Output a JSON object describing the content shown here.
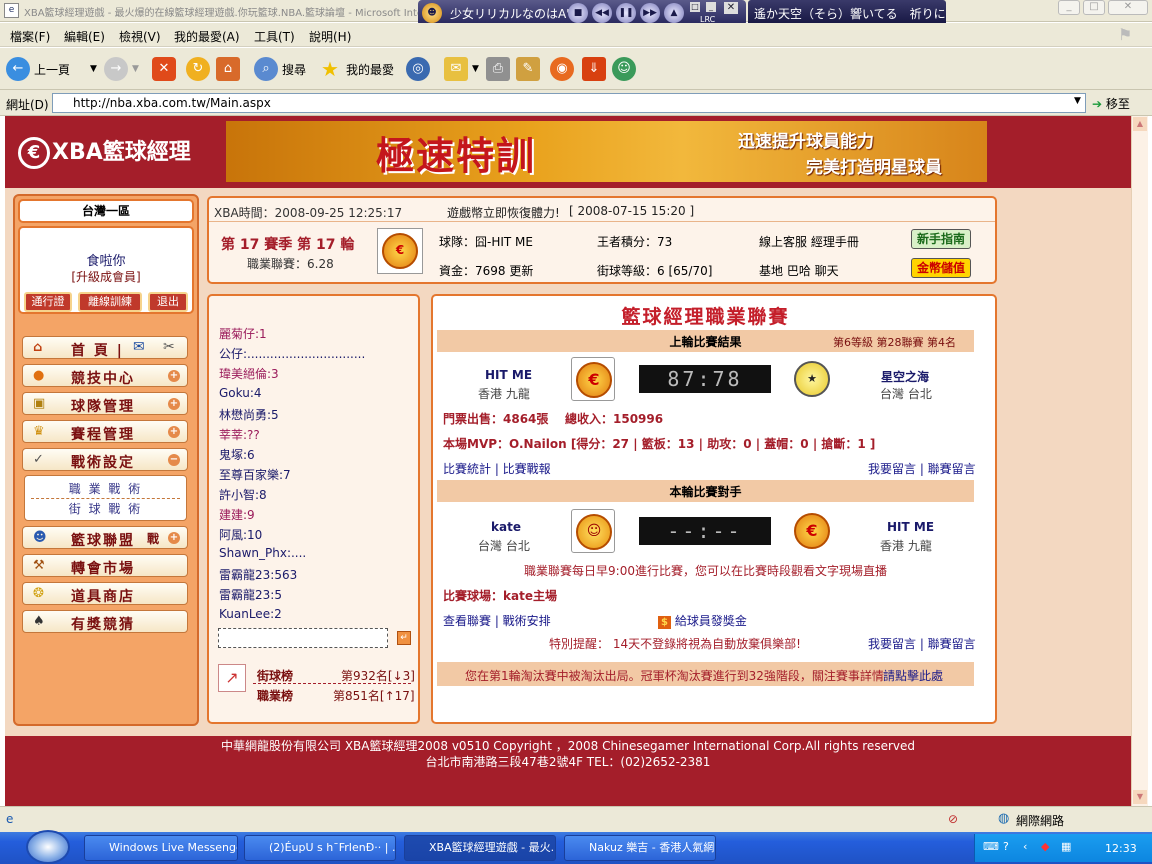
{
  "window": {
    "title": "XBA籃球經理遊戲 - 最火爆的在線籃球經理遊戲.你玩籃球.NBA.籃球論壇 - Microsoft Internet Explorer"
  },
  "player": {
    "title": "少女リリカルなのはA's",
    "lrc": "LRC",
    "lyric": "遙か天空（そら）響いてる　祈りに"
  },
  "menu": [
    "檔案(F)",
    "編輯(E)",
    "檢視(V)",
    "我的最愛(A)",
    "工具(T)",
    "說明(H)"
  ],
  "toolbar": {
    "back": "上一頁",
    "search": "搜尋",
    "favorites": "我的最愛"
  },
  "address": {
    "label": "網址(D)",
    "url": "http://nba.xba.com.tw/Main.aspx",
    "go": "移至"
  },
  "banner": {
    "logo": "XBA籃球經理",
    "ad_title": "極速特訓",
    "ad_line1": "迅速提升球員能力",
    "ad_line2": "完美打造明星球員"
  },
  "left": {
    "zone": "台灣一區",
    "username": "食啦你",
    "membership": "[升級成會員]",
    "buttons": [
      "通行證",
      "離線訓練",
      "退出"
    ],
    "nav": [
      {
        "label": "首 頁 |"
      },
      {
        "label": "競技中心"
      },
      {
        "label": "球隊管理"
      },
      {
        "label": "賽程管理"
      },
      {
        "label": "戰術設定"
      },
      {
        "label": "籃球聯盟",
        "extra": "戰"
      },
      {
        "label": "轉會市場"
      },
      {
        "label": "道具商店"
      },
      {
        "label": "有獎競猜"
      }
    ],
    "subnav": [
      "職 業 戰 術",
      "街 球 戰 術"
    ]
  },
  "info": {
    "time_label": "XBA時間：2008-09-25 12:25:17",
    "notice": "遊戲幣立即恢復體力!",
    "notice_date": "[ 2008-07-15 15:20 ]",
    "season": "第 17 賽季  第 17 輪",
    "league": "職業聯賽：6.28",
    "team": "球隊：囧-HIT ME",
    "points": "王者積分：73",
    "service": "線上客服  經理手冊",
    "money": "資金：7698 更新",
    "level": "街球等級：6 [65/70]",
    "links2": "基地  巴哈  聊天",
    "btn_guide": "新手指南",
    "btn_pay": "金幣儲值"
  },
  "names": [
    "麗菊仔:1",
    "公仔:...............................",
    "瑋美絕倫:3",
    "Goku:4",
    "林懋尚勇:5",
    "莘莘:??",
    "鬼塚:6",
    "至尊百家樂:7",
    "許小智:8",
    "建建:9",
    "阿風:10",
    "Shawn_Phx:....",
    "雷霸龍23:563",
    "雷霸龍23:5",
    "KuanLee:2"
  ],
  "ranks": {
    "street": "街球榜",
    "street_rank": "第932名[↓3]",
    "pro": "職業榜",
    "pro_rank": "第851名[↑17]"
  },
  "match": {
    "title": "籃球經理職業聯賽",
    "last_header": "上輪比賽結果",
    "last_info": "第6等級  第28聯賽  第4名",
    "home": {
      "name": "HIT ME",
      "loc": "香港  九龍"
    },
    "score": "87:78",
    "away": {
      "name": "星空之海",
      "loc": "台灣  台北"
    },
    "tickets": "門票出售：4864張",
    "income": "總收入：150996",
    "mvp": "本場MVP：O.Nailon [得分：27 | 籃板：13 | 助攻：0 | 蓋帽：0 | 搶斷：1 ]",
    "stats_links": "比賽統計 | 比賽戰報",
    "msg_links": "我要留言 | 聯賽留言",
    "next_header": "本輪比賽對手",
    "next_home": {
      "name": "kate",
      "loc": "台灣  台北"
    },
    "next_score": "--:--",
    "next_away": {
      "name": "HIT ME",
      "loc": "香港  九龍"
    },
    "schedule_note": "職業聯賽每日早9:00進行比賽，您可以在比賽時段觀看文字現場直播",
    "venue": "比賽球場：kate主場",
    "view_links": "查看聯賽 | 戰術安排",
    "bonus": "給球員發獎金",
    "warning": "特別提醒：  14天不登錄將視為自動放棄俱樂部!",
    "msg_links2": "我要留言 | 聯賽留言",
    "cup_note": "您在第1輪淘汰賽中被淘汰出局。冠軍杯淘汰賽進行到32強階段，關注賽事詳情",
    "cup_link": "請點擊此處"
  },
  "footer": {
    "line1": "中華網龍股份有限公司  XBA籃球經理2008 v0510    Copyright ，2008 Chinesegamer International Corp.All rights reserved",
    "line2": "台北市南港路三段47巷2號4F TEL：(02)2652-2381"
  },
  "status": {
    "zone": "網際網路"
  },
  "taskbar": {
    "items": [
      "Windows Live Messenger",
      "(2)ÉupU s h¯FrIenÐ·· | ...",
      "XBA籃球經理遊戲 - 最火...",
      "Nakuz 樂吉 - 香港人氣網..."
    ],
    "clock": "12:33"
  },
  "colors": {
    "brand_red": "#a41e2a",
    "accent_orange": "#e4762e",
    "page_bg": "#f3d8c1"
  }
}
